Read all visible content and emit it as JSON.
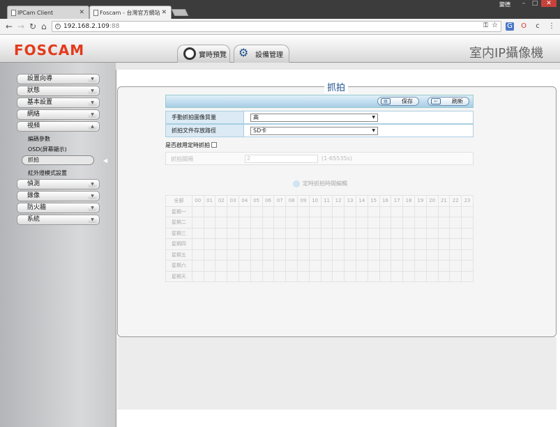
{
  "browser": {
    "tabs": [
      {
        "title": "IPCam Client"
      },
      {
        "title": "Foscam - 台灣官方網站"
      }
    ],
    "user": "變德",
    "url_host": "192.168.2.109",
    "url_port": ":88"
  },
  "header": {
    "logo": "FOSCAM",
    "product": "室内IP攝像機",
    "tabs": [
      {
        "label": "實時預覽"
      },
      {
        "label": "設備管理"
      }
    ]
  },
  "sidebar": {
    "items": [
      {
        "label": "設置向導"
      },
      {
        "label": "狀態"
      },
      {
        "label": "基本設置"
      },
      {
        "label": "網絡"
      },
      {
        "label": "視頻"
      }
    ],
    "sub_items": [
      {
        "label": "編碼參數"
      },
      {
        "label": "OSD(屏幕顯示)"
      },
      {
        "label": "抓拍"
      },
      {
        "label": "紅外燈模式設置"
      }
    ],
    "items_bottom": [
      {
        "label": "偵測"
      },
      {
        "label": "錄像"
      },
      {
        "label": "防火牆"
      },
      {
        "label": "系統"
      }
    ]
  },
  "panel": {
    "title": "抓拍",
    "save_label": "保存",
    "refresh_label": "刷新",
    "fields": [
      {
        "label": "手動抓拍圖像質量",
        "value": "高"
      },
      {
        "label": "抓拍文件存放路徑",
        "value": "SD卡"
      }
    ],
    "timed_label": "是否啟用定時抓拍",
    "interval": {
      "label": "抓拍間隔",
      "value": "2",
      "hint": "(1-65535s)"
    },
    "schedule_edit": "定時抓拍時間編輯",
    "schedule": {
      "corner": "全部",
      "hours": [
        "00",
        "01",
        "02",
        "03",
        "04",
        "05",
        "06",
        "07",
        "08",
        "09",
        "10",
        "11",
        "12",
        "13",
        "14",
        "15",
        "16",
        "17",
        "18",
        "19",
        "20",
        "21",
        "22",
        "23"
      ],
      "days": [
        "星期一",
        "星期二",
        "星期三",
        "星期四",
        "星期五",
        "星期六",
        "星期天"
      ]
    }
  }
}
